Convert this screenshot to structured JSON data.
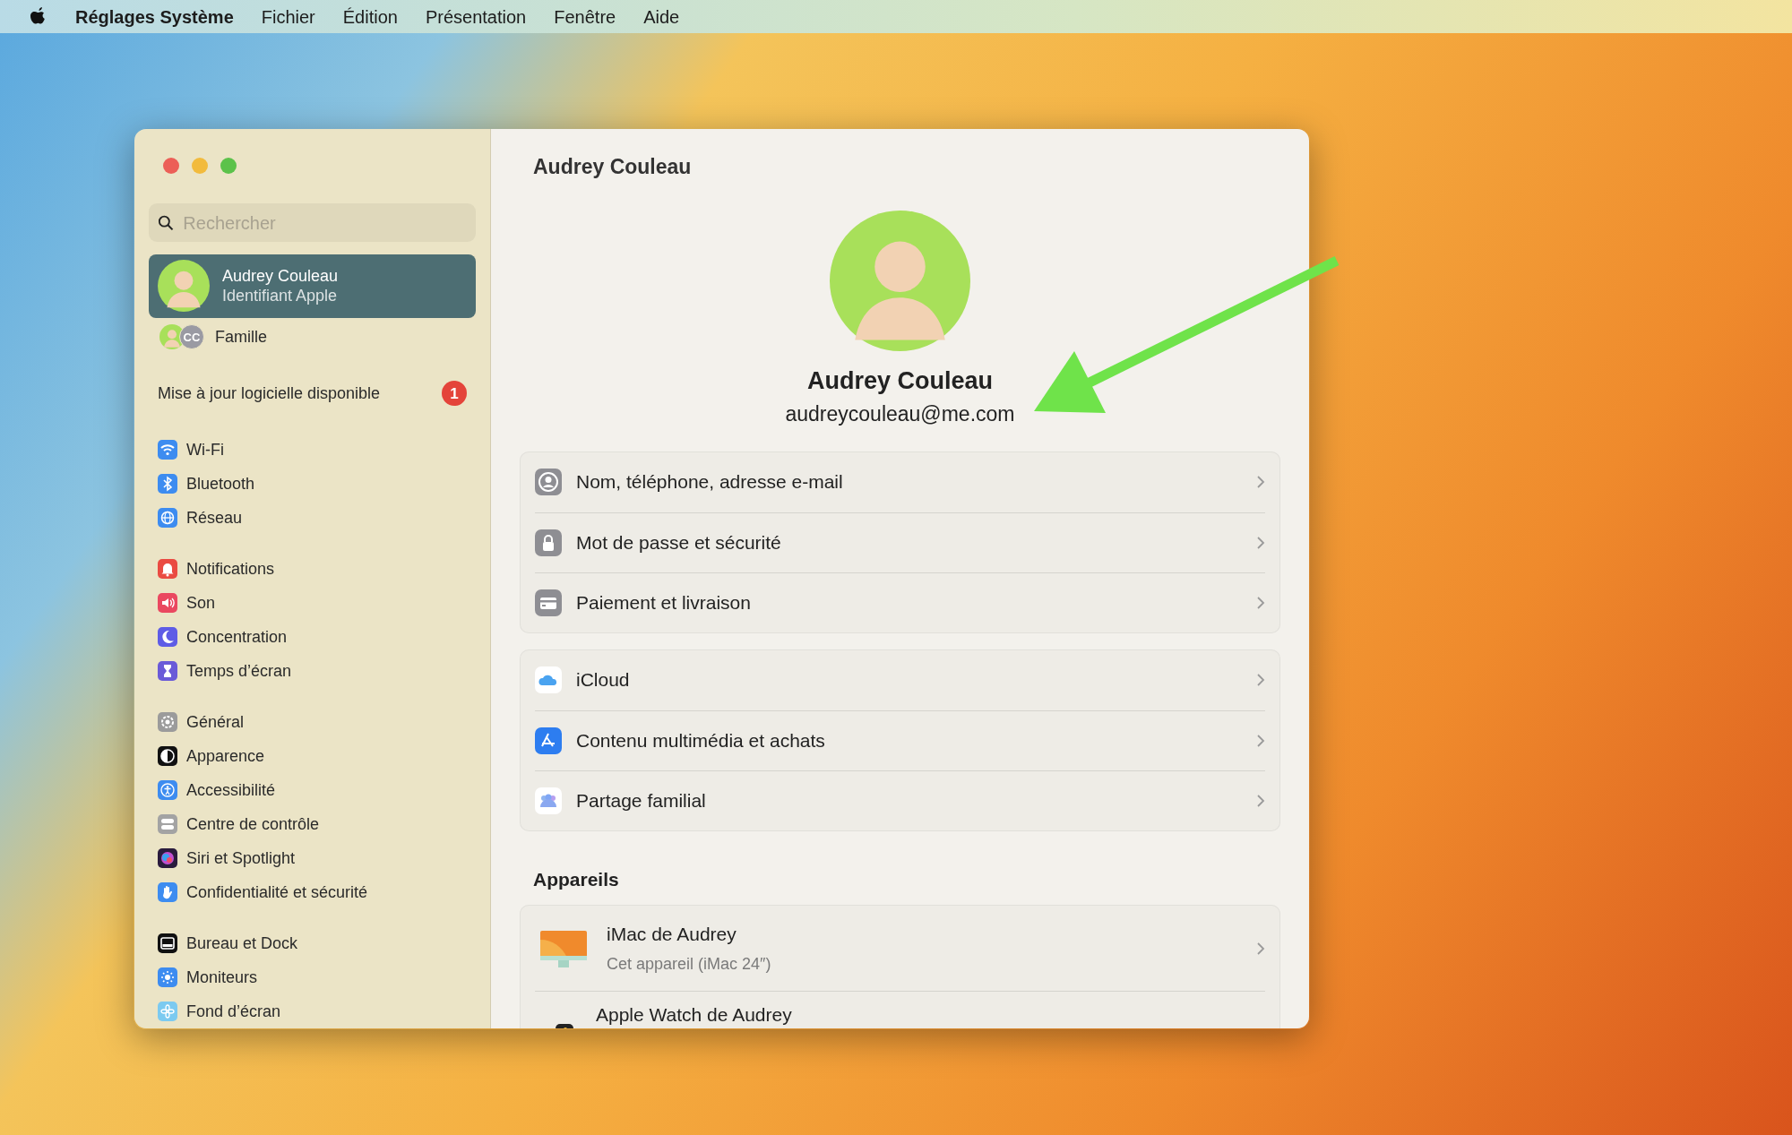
{
  "menu_bar": {
    "app_name": "Réglages Système",
    "items": [
      "Fichier",
      "Édition",
      "Présentation",
      "Fenêtre",
      "Aide"
    ]
  },
  "sidebar": {
    "search": {
      "placeholder": "Rechercher"
    },
    "account": {
      "name": "Audrey Couleau",
      "subtitle": "Identifiant Apple",
      "selected": true
    },
    "family": {
      "label": "Famille",
      "initials": "CC",
      "selected": false
    },
    "update": {
      "label": "Mise à jour logicielle disponible",
      "badge": "1"
    },
    "groups": [
      [
        {
          "label": "Wi-Fi",
          "selected": false
        },
        {
          "label": "Bluetooth",
          "selected": false
        },
        {
          "label": "Réseau",
          "selected": false
        }
      ],
      [
        {
          "label": "Notifications",
          "selected": false
        },
        {
          "label": "Son",
          "selected": false
        },
        {
          "label": "Concentration",
          "selected": false
        },
        {
          "label": "Temps d’écran",
          "selected": false
        }
      ],
      [
        {
          "label": "Général",
          "selected": false
        },
        {
          "label": "Apparence",
          "selected": false
        },
        {
          "label": "Accessibilité",
          "selected": false
        },
        {
          "label": "Centre de contrôle",
          "selected": false
        },
        {
          "label": "Siri et Spotlight",
          "selected": false
        },
        {
          "label": "Confidentialité et sécurité",
          "selected": false
        }
      ],
      [
        {
          "label": "Bureau et Dock",
          "selected": false
        },
        {
          "label": "Moniteurs",
          "selected": false
        },
        {
          "label": "Fond d’écran",
          "selected": false
        }
      ]
    ]
  },
  "main": {
    "title": "Audrey Couleau",
    "profile": {
      "name": "Audrey Couleau",
      "email": "audreycouleau@me.com"
    },
    "groups": [
      [
        {
          "label": "Nom, téléphone, adresse e-mail"
        },
        {
          "label": "Mot de passe et sécurité"
        },
        {
          "label": "Paiement et livraison"
        }
      ],
      [
        {
          "label": "iCloud"
        },
        {
          "label": "Contenu multimédia et achats"
        },
        {
          "label": "Partage familial"
        }
      ]
    ],
    "devices": {
      "title": "Appareils",
      "items": [
        {
          "name": "iMac de Audrey",
          "detail": "Cet appareil (iMac 24″)"
        },
        {
          "name": "Apple Watch de Audrey"
        }
      ]
    }
  }
}
